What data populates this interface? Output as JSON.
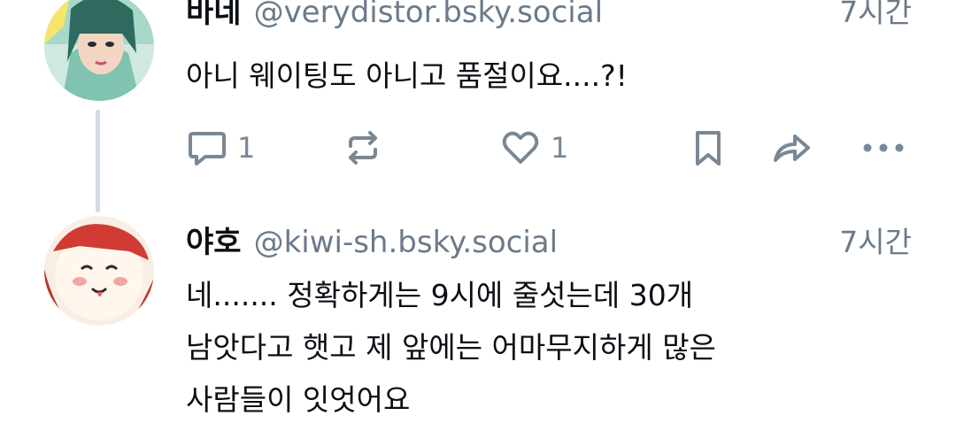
{
  "posts": [
    {
      "author": "바네",
      "handle": "@verydistor.bsky.social",
      "time": "7시간",
      "lines": [
        "아니 웨이팅도 아니고 품절이요....?!"
      ],
      "reply_count": "1",
      "like_count": "1"
    },
    {
      "author": "야호",
      "handle": "@kiwi-sh.bsky.social",
      "time": "7시간",
      "lines": [
        "네....... 정확하게는 9시에 줄섯는데 30개",
        "남앗다고 햇고 제 앞에는 어마무지하게 많은",
        "사람들이 잇엇어요"
      ]
    }
  ],
  "icons": {
    "reply": "comment-bubble-icon",
    "repost": "repost-arrows-icon",
    "like": "heart-icon",
    "bookmark": "bookmark-icon",
    "share": "share-arrow-icon",
    "more": "more-dots-icon"
  },
  "colors": {
    "text": "#0b0f14",
    "secondary": "#6b7a8a",
    "icon": "#7a8794",
    "thread_line": "#d4dbe2"
  }
}
